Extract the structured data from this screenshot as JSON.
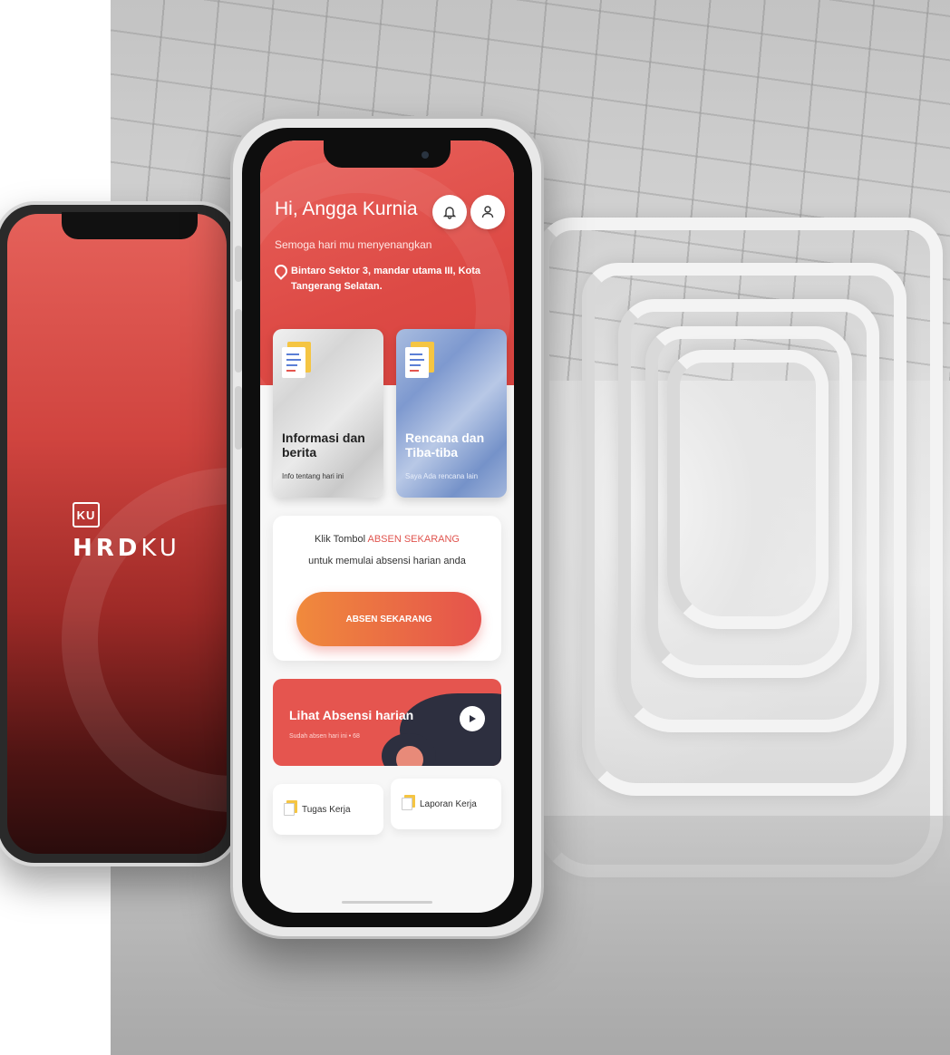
{
  "colors": {
    "accent": "#e0544e",
    "button_start": "#f08a3c",
    "dark_blob": "#2d2f3f"
  },
  "splash": {
    "logo_badge": "KU",
    "brand_bold": "HRD",
    "brand_light": "KU"
  },
  "header": {
    "greeting": "Hi, Angga Kurnia",
    "subtitle": "Semoga hari mu menyenangkan",
    "address": "Bintaro Sektor 3, mandar utama III, Kota Tangerang Selatan.",
    "icons": {
      "notification": "bell-icon",
      "profile": "user-icon",
      "location": "pin-icon"
    }
  },
  "cards": [
    {
      "title": "Informasi dan berita",
      "subtitle": "Info tentang hari ini"
    },
    {
      "title": "Rencana dan Tiba-tiba",
      "subtitle": "Saya Ada rencana lain"
    }
  ],
  "absen": {
    "prompt_prefix": "Klik Tombol ",
    "prompt_highlight": "ABSEN SEKARANG",
    "prompt_suffix": "untuk memulai absensi harian anda",
    "button_label": "ABSEN SEKARANG"
  },
  "attendance": {
    "title": "Lihat Absensi harian",
    "subtitle": "Sudah absen hari ini  •  68",
    "play_icon": "play-icon"
  },
  "quick_links": [
    {
      "label": "Tugas Kerja",
      "icon": "document-icon"
    },
    {
      "label": "Laporan Kerja",
      "icon": "document-icon"
    }
  ]
}
